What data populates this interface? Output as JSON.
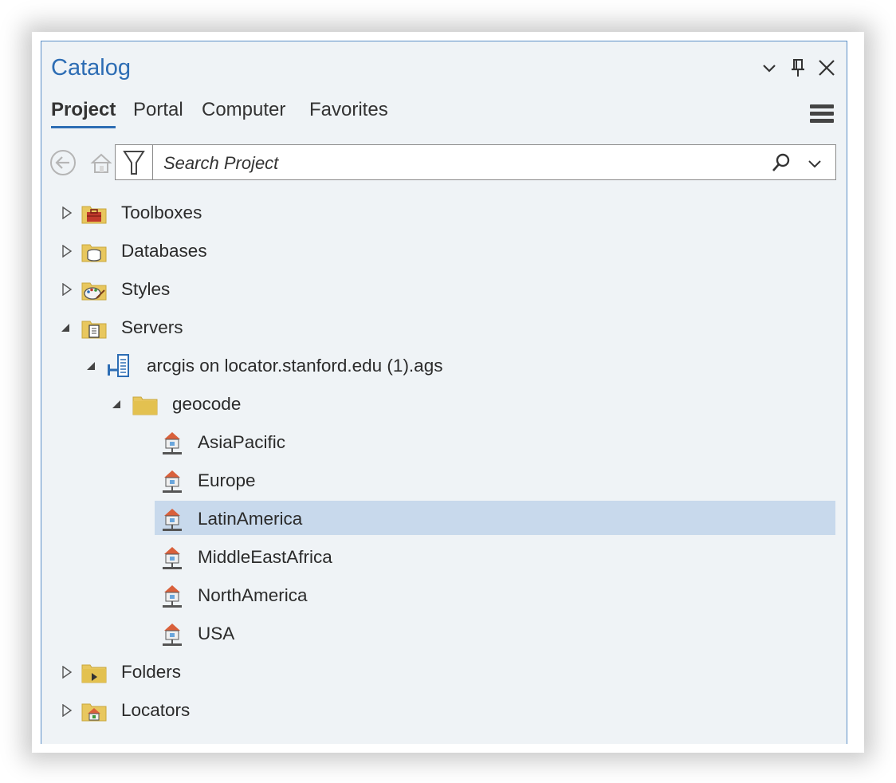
{
  "panel": {
    "title": "Catalog"
  },
  "tabs": [
    {
      "label": "Project",
      "active": true
    },
    {
      "label": "Portal",
      "active": false
    },
    {
      "label": "Computer",
      "active": false
    },
    {
      "label": "Favorites",
      "active": false
    }
  ],
  "search": {
    "placeholder": "Search Project",
    "value": ""
  },
  "tree": {
    "toolboxes": "Toolboxes",
    "databases": "Databases",
    "styles": "Styles",
    "servers": "Servers",
    "server_connection": "arcgis on locator.stanford.edu (1).ags",
    "geocode_folder": "geocode",
    "locators": [
      {
        "label": "AsiaPacific"
      },
      {
        "label": "Europe"
      },
      {
        "label": "LatinAmerica",
        "selected": true
      },
      {
        "label": "MiddleEastAfrica"
      },
      {
        "label": "NorthAmerica"
      },
      {
        "label": "USA"
      }
    ],
    "folders": "Folders",
    "locators_folder": "Locators"
  },
  "colors": {
    "accent": "#2d6db4",
    "panel_bg": "#eff3f6",
    "selection": "#c8d9ec",
    "folder": "#e8c75e"
  }
}
